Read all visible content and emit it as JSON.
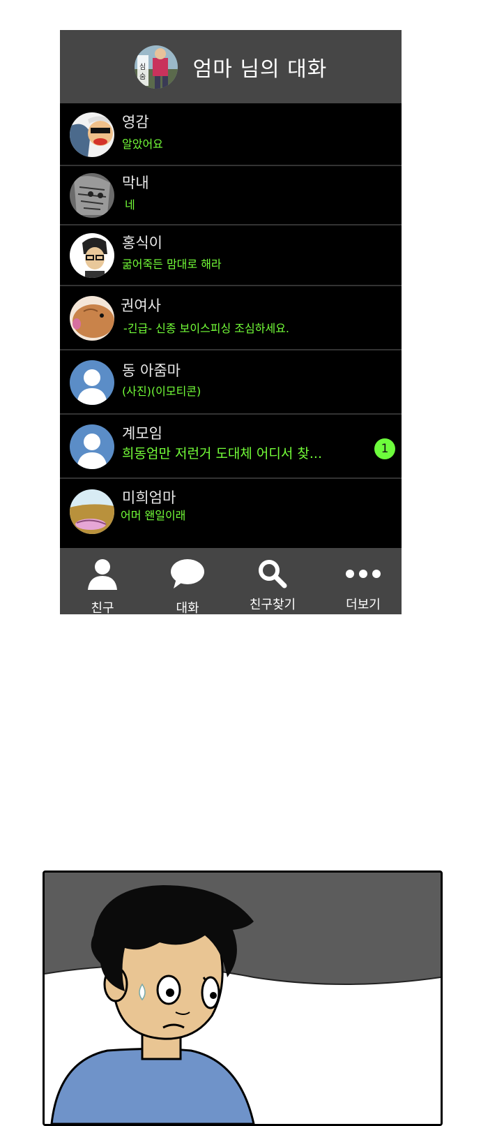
{
  "header": {
    "title": "엄마 님의 대화"
  },
  "chats": [
    {
      "name": "영감",
      "message": "알았어요",
      "unread": ""
    },
    {
      "name": "막내",
      "message": "네",
      "unread": ""
    },
    {
      "name": "홍식이",
      "message": "굶어죽든 맘대로 해라",
      "unread": ""
    },
    {
      "name": "권여사",
      "message": "-긴급- 신종 보이스피싱 조심하세요.",
      "unread": ""
    },
    {
      "name": "동 아줌마",
      "message": "(사진)(이모티콘)",
      "unread": ""
    },
    {
      "name": "계모임",
      "message": "희동엄만 저런거 도대체 어디서 찾...",
      "unread": "1"
    },
    {
      "name": "미희엄마",
      "message": "어머 왠일이래",
      "unread": ""
    }
  ],
  "tabs": [
    {
      "label": "친구",
      "icon": "person-icon"
    },
    {
      "label": "대화",
      "icon": "speech-bubble-icon"
    },
    {
      "label": "친구찾기",
      "icon": "search-icon"
    },
    {
      "label": "더보기",
      "icon": "more-dots-icon"
    }
  ],
  "colors": {
    "message_green": "#74ff39",
    "badge_green": "#6dfc3c",
    "header_gray": "#464646",
    "tabbar_gray": "#454545",
    "default_avatar_blue": "#5b8dc7"
  }
}
